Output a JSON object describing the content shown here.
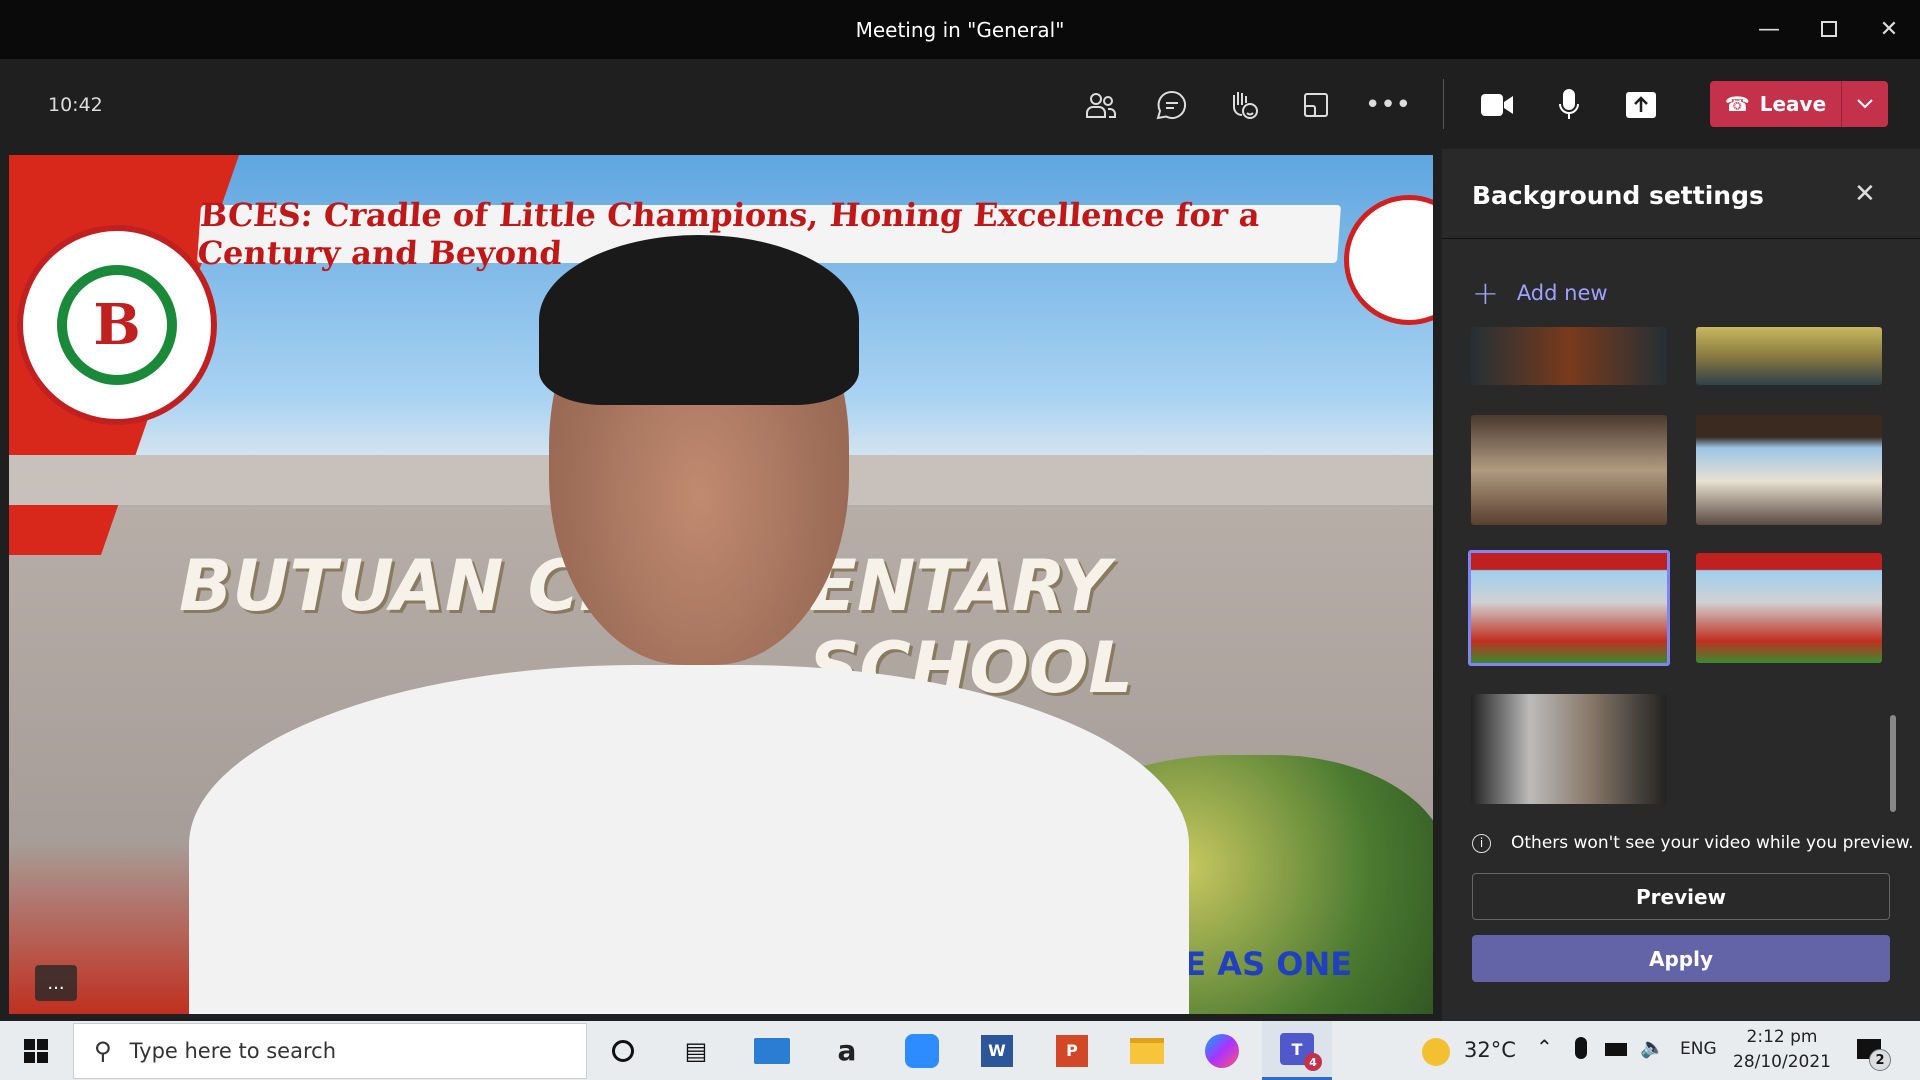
{
  "window": {
    "title": "Meeting in \"General\""
  },
  "toolbar": {
    "time": "10:42",
    "leave_label": "Leave",
    "leave_color": "#c4314b",
    "icons": [
      "people-icon",
      "chat-icon",
      "reactions-icon",
      "rooms-icon",
      "more-icon",
      "camera-icon",
      "mic-icon",
      "share-icon"
    ]
  },
  "video": {
    "banner": "BCES: Cradle of Little Champions, Honing Excellence for a Century and Beyond",
    "wall_sign_left": "BUTUAN CENT",
    "wall_sign_right": "ENTARY SCHOOL",
    "bottom_text": "WE AS ONE",
    "logo_text": "BUTUAN CENTRAL ELEMENTARY SCHOOL",
    "more_label": "..."
  },
  "panel": {
    "title": "Background settings",
    "add_new": "Add new",
    "info": "Others won't see your video while you preview.",
    "preview": "Preview",
    "apply": "Apply",
    "accent": "#6264a7",
    "selected_index": 4
  },
  "taskbar": {
    "search_placeholder": "Type here to search",
    "temperature": "32°C",
    "language": "ENG",
    "time": "2:12 pm",
    "date": "28/10/2021",
    "notifications": "2",
    "teams_badge": "4"
  }
}
